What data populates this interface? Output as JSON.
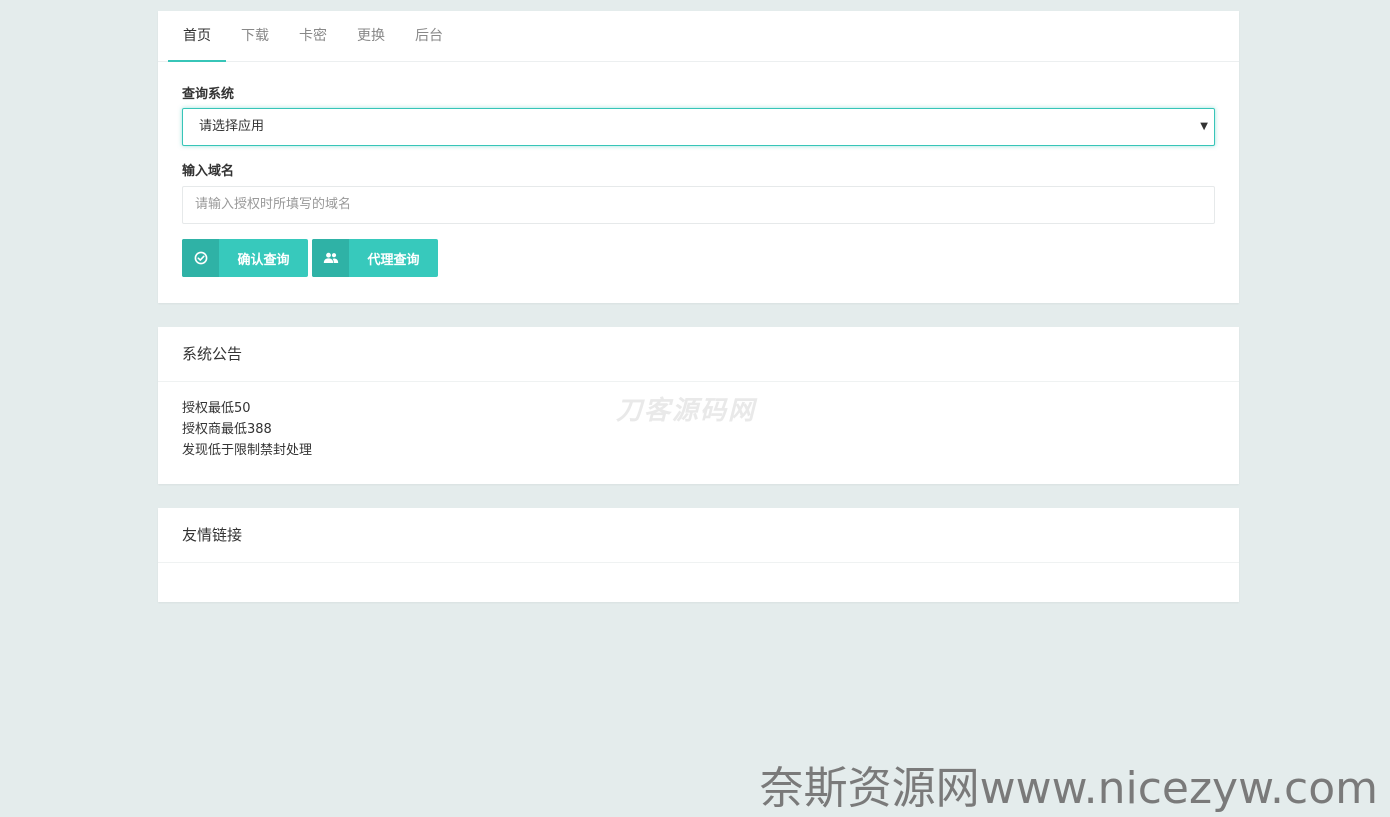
{
  "tabs": [
    {
      "label": "首页"
    },
    {
      "label": "下载"
    },
    {
      "label": "卡密"
    },
    {
      "label": "更换"
    },
    {
      "label": "后台"
    }
  ],
  "query": {
    "system_label": "查询系统",
    "select_value": "请选择应用",
    "domain_label": "输入域名",
    "domain_placeholder": "请输入授权时所填写的域名",
    "confirm_label": "确认查询",
    "agent_label": "代理查询"
  },
  "notice": {
    "title": "系统公告",
    "lines": [
      "授权最低50",
      "授权商最低388",
      "发现低于限制禁封处理"
    ],
    "watermark": "刀客源码网"
  },
  "links": {
    "title": "友情链接"
  },
  "footer_watermark": "奈斯资源网www.nicezyw.com",
  "colors": {
    "accent": "#37c9bc",
    "accent_dark": "#2fb2a6",
    "background": "#e4ecec"
  }
}
